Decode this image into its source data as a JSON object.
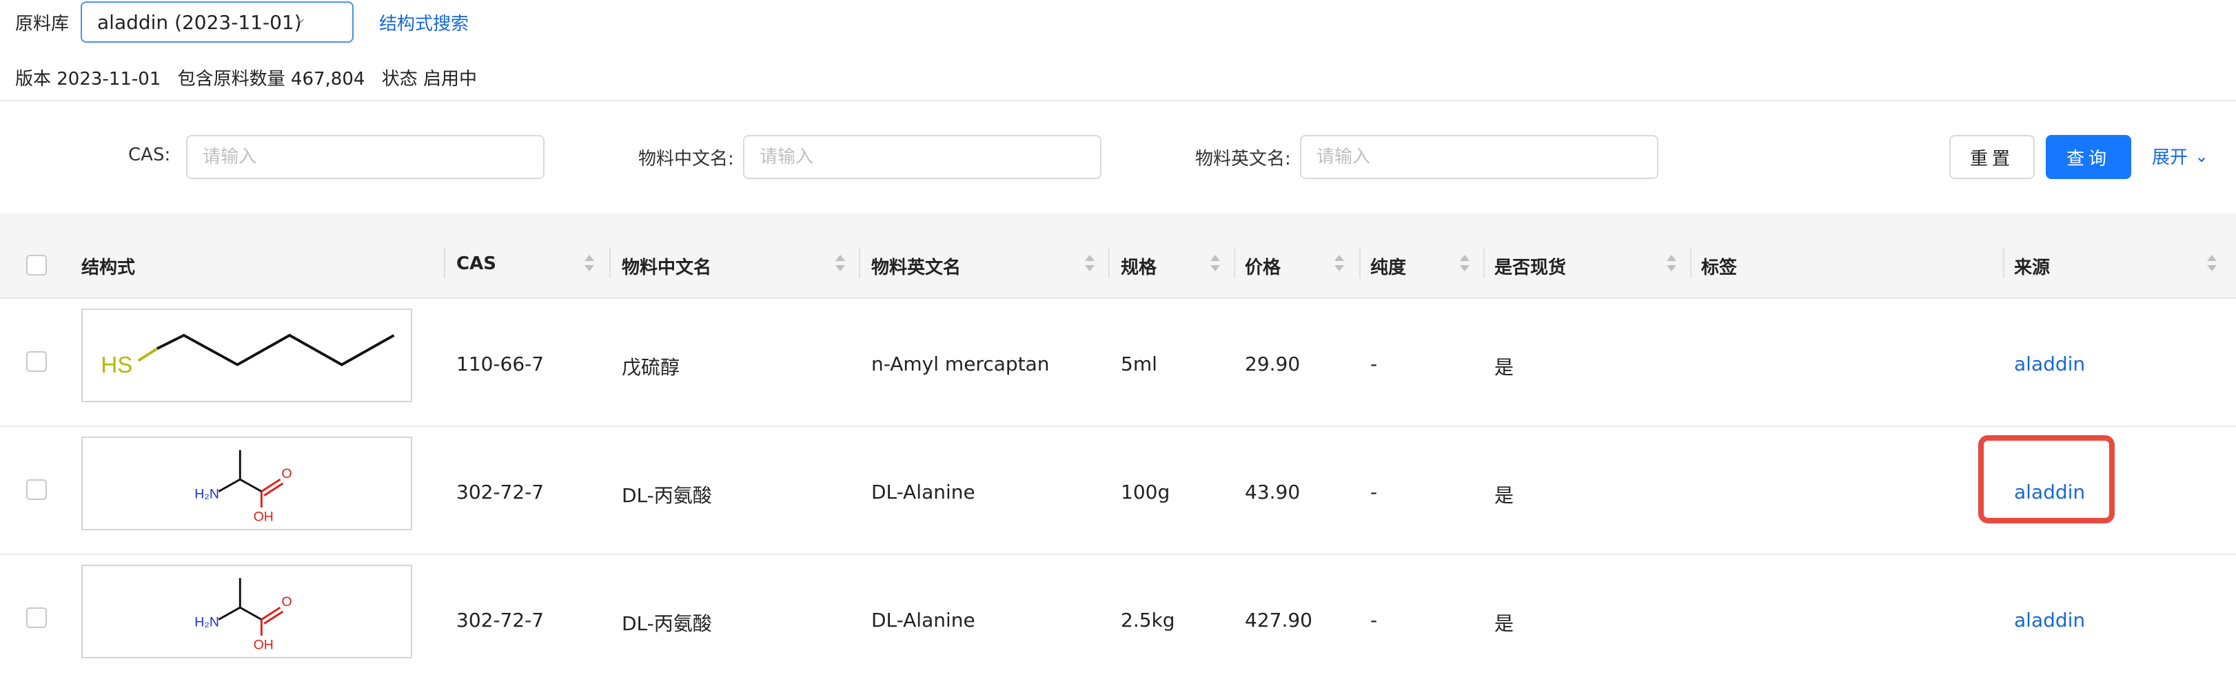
{
  "library": {
    "label": "原料库",
    "selected": "aladdin (2023-11-01)",
    "structure_search_link": "结构式搜索"
  },
  "info": {
    "version": "版本 2023-11-01",
    "count": "包含原料数量 467,804",
    "status": "状态 启用中"
  },
  "filters": {
    "cas_label": "CAS:",
    "cas_placeholder": "请输入",
    "cn_label": "物料中文名:",
    "cn_placeholder": "请输入",
    "en_label": "物料英文名:",
    "en_placeholder": "请输入",
    "reset_label": "重置",
    "query_label": "查询",
    "expand_label": "展开"
  },
  "table": {
    "headers": {
      "structure": "结构式",
      "cas": "CAS",
      "cn_name": "物料中文名",
      "en_name": "物料英文名",
      "spec": "规格",
      "price": "价格",
      "purity": "纯度",
      "in_stock": "是否现货",
      "tags": "标签",
      "source": "来源"
    },
    "rows": [
      {
        "structure": "pentanethiol",
        "structure_label": "HS",
        "cas": "110-66-7",
        "cn_name": "戊硫醇",
        "en_name": "n-Amyl mercaptan",
        "spec": "5ml",
        "price": "29.90",
        "purity": "-",
        "in_stock": "是",
        "tags": "",
        "source": "aladdin"
      },
      {
        "structure": "alanine",
        "structure_labels": {
          "amine": "H₂N",
          "carbonyl": "O",
          "hydroxyl": "OH"
        },
        "cas": "302-72-7",
        "cn_name": "DL-丙氨酸",
        "en_name": "DL-Alanine",
        "spec": "100g",
        "price": "43.90",
        "purity": "-",
        "in_stock": "是",
        "tags": "",
        "source": "aladdin"
      },
      {
        "structure": "alanine",
        "structure_labels": {
          "amine": "H₂N",
          "carbonyl": "O",
          "hydroxyl": "OH"
        },
        "cas": "302-72-7",
        "cn_name": "DL-丙氨酸",
        "en_name": "DL-Alanine",
        "spec": "2.5kg",
        "price": "427.90",
        "purity": "-",
        "in_stock": "是",
        "tags": "",
        "source": "aladdin"
      }
    ]
  },
  "colors": {
    "accent": "#1677ff",
    "link": "#1668dc",
    "highlight": "#e84a3f",
    "sulfur": "#b5b800",
    "nitrogen": "#1a2ee0",
    "oxygen": "#e0201a"
  }
}
